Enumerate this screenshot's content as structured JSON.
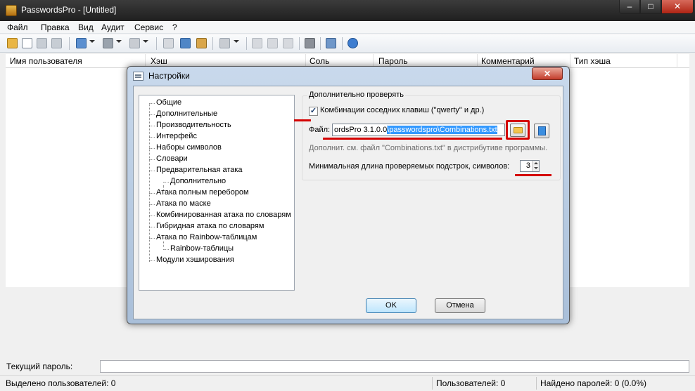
{
  "window": {
    "title": "PasswordsPro - [Untitled]",
    "min": "–",
    "max": "□",
    "close": "✕"
  },
  "menu": [
    "Файл",
    "Правка",
    "Вид",
    "Аудит",
    "Сервис",
    "?"
  ],
  "toolbar_icons": [
    "open-icon",
    "new-icon",
    "save-icon",
    "save-as-icon",
    "copy-icon",
    "search-icon",
    "remove-icon",
    "edit-icon",
    "import-icon",
    "paste-icon",
    "tools-icon",
    "run-icon",
    "pause-icon",
    "stop-icon",
    "settings-icon",
    "options-icon",
    "web-icon"
  ],
  "columns": [
    "Имя пользователя",
    "Хэш",
    "Соль",
    "Пароль",
    "Комментарий",
    "Тип хэша"
  ],
  "current_password": {
    "label": "Текущий пароль:",
    "value": ""
  },
  "status": {
    "selected": "Выделено пользователей: 0",
    "users": "Пользователей: 0",
    "found": "Найдено паролей: 0 (0.0%)"
  },
  "dialog": {
    "title": "Настройки",
    "close": "✕",
    "tree": [
      "Общие",
      "Дополнительные",
      "Производительность",
      "Интерфейс",
      "Наборы символов",
      "Словари",
      "Предварительная атака",
      "Дополнительно",
      "Атака полным перебором",
      "Атака по маске",
      "Комбинированная атака по словарям",
      "Гибридная атака по словарям",
      "Атака по Rainbow-таблицам",
      "Rainbow-таблицы",
      "Модули хэширования"
    ],
    "group_title": "Дополнительно проверять",
    "checkbox_label": "Комбинации соседних клавиш (\"qwerty\" и др.)",
    "checkbox_checked": true,
    "file_label": "Файл:",
    "file_value_plain": "ordsPro 3.1.0.0",
    "file_value_selected": "\\passwordspro\\Combinations.txt",
    "hint": "Дополнит. см. файл \"Combinations.txt\" в дистрибутиве программы.",
    "minlen_label": "Минимальная длина проверяемых подстрок, символов:",
    "minlen_value": "3",
    "ok": "OK",
    "cancel": "Отмена"
  }
}
